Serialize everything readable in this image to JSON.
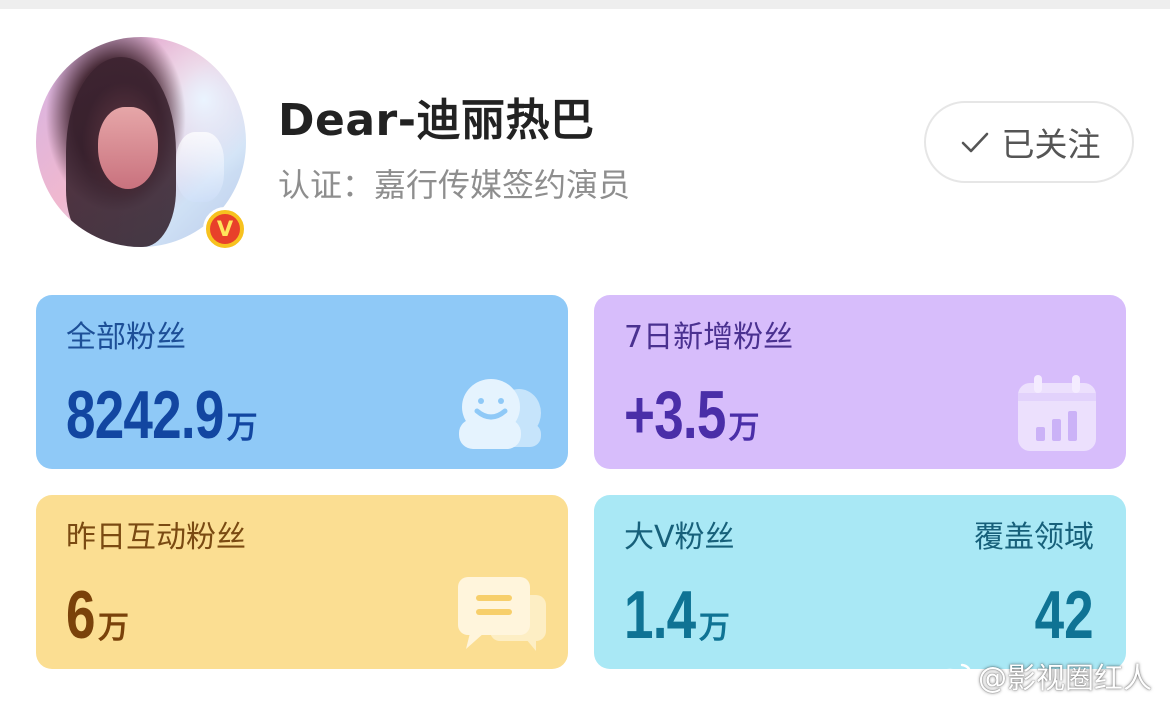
{
  "profile": {
    "username": "Dear-迪丽热巴",
    "verification": "认证：嘉行传媒签约演员",
    "badge_letter": "V",
    "follow_label": "已关注",
    "follow_icon": "check-icon"
  },
  "stats": {
    "total_fans": {
      "label": "全部粉丝",
      "value": "8242.9",
      "unit": "万",
      "icon": "fans-icon",
      "color": "#8fc9f7"
    },
    "new_fans_7d": {
      "label": "7日新增粉丝",
      "value": "+3.5",
      "unit": "万",
      "icon": "calendar-chart-icon",
      "color": "#d7bdfb"
    },
    "interactive_fans": {
      "label": "昨日互动粉丝",
      "value": "6",
      "unit": "万",
      "icon": "chat-icon",
      "color": "#fbde92"
    },
    "bigv_fans": {
      "label": "大V粉丝",
      "value": "1.4",
      "unit": "万",
      "color": "#a9e8f5"
    },
    "coverage": {
      "label": "覆盖领域",
      "value": "42"
    }
  },
  "watermark": {
    "text": "@影视圈红人",
    "icon": "weibo-icon"
  }
}
